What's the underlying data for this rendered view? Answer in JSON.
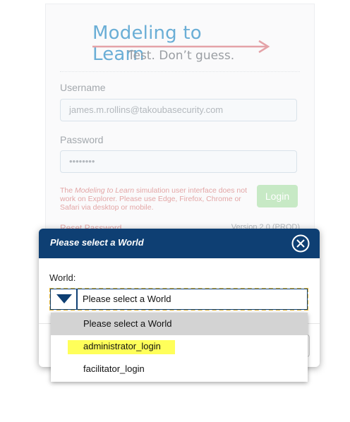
{
  "login": {
    "logo_title": "Modeling to Learn",
    "logo_tagline": "Test. Don’t guess.",
    "username_label": "Username",
    "username_value": "james.m.rollins@takoubasecurity.com",
    "password_label": "Password",
    "password_value": "••••••••",
    "warning_prefix": "The ",
    "warning_emph": "Modeling to Learn",
    "warning_suffix": " simulation user interface does not work on Explorer. Please use Edge, Firefox, Chrome or Safari via desktop or mobile.",
    "login_button": "Login",
    "reset_link": "Reset Password",
    "version": "Version 2.0 (PROD)"
  },
  "modal": {
    "title": "Please select a World",
    "field_label": "World:",
    "selected_value": "Please select a World",
    "options": [
      "Please select a World",
      "administrator_login",
      "facilitator_login"
    ]
  },
  "colors": {
    "header": "#0e3f73",
    "focus_dash": "#e8b838",
    "highlight": "#ffff5a",
    "logo_blue": "#6aaed6",
    "login_green": "#c7e9c5"
  },
  "icons": {
    "close": "close-circle-icon",
    "dropdown": "triangle-down-icon"
  }
}
